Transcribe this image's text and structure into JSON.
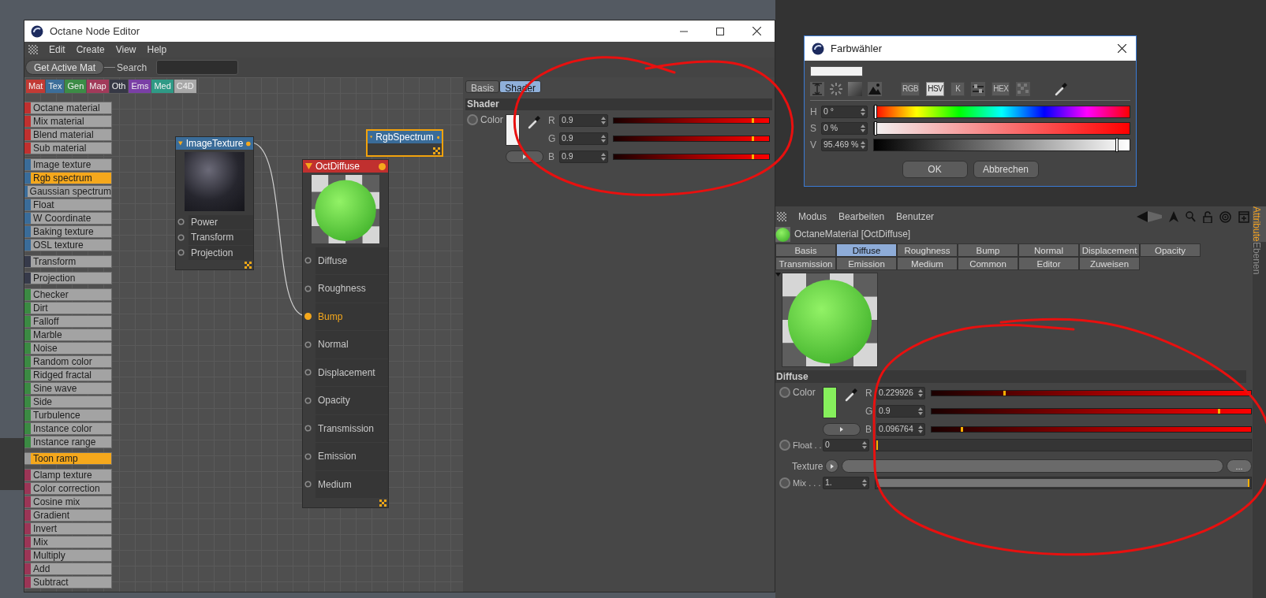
{
  "node_editor": {
    "title": "Octane Node Editor",
    "menu": [
      "Edit",
      "Create",
      "View",
      "Help"
    ],
    "toolbar": {
      "button": "Get Active Mat",
      "search_label": "Search"
    },
    "category_tabs": [
      {
        "label": "Mat",
        "color": "#c23a34"
      },
      {
        "label": "Tex",
        "color": "#3c6e9a"
      },
      {
        "label": "Gen",
        "color": "#3c8c46"
      },
      {
        "label": "Map",
        "color": "#a23a5a"
      },
      {
        "label": "Oth",
        "color": "#363845"
      },
      {
        "label": "Ems",
        "color": "#7a3fa6"
      },
      {
        "label": "Med",
        "color": "#2f9a86"
      },
      {
        "label": "C4D",
        "color": "#a8a8a8"
      }
    ],
    "node_groups": [
      {
        "color": "#c0302f",
        "items": [
          {
            "label": "Octane material",
            "selected": false
          },
          {
            "label": "Mix material",
            "selected": false
          },
          {
            "label": "Blend material",
            "selected": false
          },
          {
            "label": "Sub material",
            "selected": false
          }
        ]
      },
      {
        "color": "#3a6c99",
        "items": [
          {
            "label": "Image texture",
            "selected": false
          },
          {
            "label": "Rgb spectrum",
            "selected": true
          },
          {
            "label": "Gaussian spectrum",
            "selected": false
          },
          {
            "label": "Float",
            "selected": false
          },
          {
            "label": "W Coordinate",
            "selected": false
          },
          {
            "label": "Baking texture",
            "selected": false
          },
          {
            "label": "OSL texture",
            "selected": false
          }
        ]
      },
      {
        "color": "#363a4a",
        "items": [
          {
            "label": "Transform",
            "selected": false
          }
        ]
      },
      {
        "color": "#363a4a",
        "items": [
          {
            "label": "Projection",
            "selected": false
          }
        ]
      },
      {
        "color": "#3b8a43",
        "items": [
          {
            "label": "Checker",
            "selected": false
          },
          {
            "label": "Dirt",
            "selected": false
          },
          {
            "label": "Falloff",
            "selected": false
          },
          {
            "label": "Marble",
            "selected": false
          },
          {
            "label": "Noise",
            "selected": false
          },
          {
            "label": "Random color",
            "selected": false
          },
          {
            "label": "Ridged fractal",
            "selected": false
          },
          {
            "label": "Sine wave",
            "selected": false
          },
          {
            "label": "Side",
            "selected": false
          },
          {
            "label": "Turbulence",
            "selected": false
          },
          {
            "label": "Instance color",
            "selected": false
          },
          {
            "label": "Instance range",
            "selected": false
          }
        ]
      },
      {
        "color": "#9a9a9a",
        "items": [
          {
            "label": "Toon ramp",
            "selected": true
          }
        ]
      },
      {
        "color": "#9b3556",
        "items": [
          {
            "label": "Clamp texture",
            "selected": false
          },
          {
            "label": "Color correction",
            "selected": false
          },
          {
            "label": "Cosine mix",
            "selected": false
          },
          {
            "label": "Gradient",
            "selected": false
          },
          {
            "label": "Invert",
            "selected": false
          },
          {
            "label": "Mix",
            "selected": false
          },
          {
            "label": "Multiply",
            "selected": false
          },
          {
            "label": "Add",
            "selected": false
          },
          {
            "label": "Subtract",
            "selected": false
          }
        ]
      }
    ],
    "nodes": [
      {
        "kind": "texture",
        "title": "ImageTexture",
        "color": "#3a6c99",
        "selected": false,
        "ports": [
          {
            "label": "Power",
            "connected": false
          },
          {
            "label": "Transform",
            "connected": false
          },
          {
            "label": "Projection",
            "connected": false
          }
        ]
      },
      {
        "kind": "shader",
        "title": "OctDiffuse",
        "color": "#c0302f",
        "selected": false,
        "ports": [
          {
            "label": "Diffuse",
            "connected": false
          },
          {
            "label": "Roughness",
            "connected": false
          },
          {
            "label": "Bump",
            "connected": true
          },
          {
            "label": "Normal",
            "connected": false
          },
          {
            "label": "Displacement",
            "connected": false
          },
          {
            "label": "Opacity",
            "connected": false
          },
          {
            "label": "Transmission",
            "connected": false
          },
          {
            "label": "Emission",
            "connected": false
          },
          {
            "label": "Medium",
            "connected": false
          }
        ]
      },
      {
        "kind": "spectrum",
        "title": "RgbSpectrum",
        "color": "#3a6c99",
        "selected": true
      }
    ],
    "panel": {
      "tabs": [
        {
          "label": "Basis",
          "selected": false
        },
        {
          "label": "Shader",
          "selected": true
        }
      ],
      "section": "Shader",
      "color_label": "Color",
      "channels": [
        {
          "label": "R",
          "value": "0.9",
          "level": 0.9
        },
        {
          "label": "G",
          "value": "0.9",
          "level": 0.9
        },
        {
          "label": "B",
          "value": "0.9",
          "level": 0.9
        }
      ]
    }
  },
  "color_picker": {
    "title": "Farbwähler",
    "modes": [
      {
        "label": "RGB",
        "selected": false
      },
      {
        "label": "HSV",
        "selected": true
      },
      {
        "label": "K",
        "selected": false
      },
      {
        "label": "HEX",
        "selected": false
      }
    ],
    "rows": [
      {
        "kind": "hue",
        "label": "H",
        "value": "0 °",
        "level": 0
      },
      {
        "kind": "saturation",
        "label": "S",
        "value": "0 %",
        "level": 0
      },
      {
        "kind": "value",
        "label": "V",
        "value": "95.469 %",
        "level": 0.955
      }
    ],
    "buttons": [
      "OK",
      "Abbrechen"
    ]
  },
  "attribute_manager": {
    "menu": [
      "Modus",
      "Bearbeiten",
      "Benutzer"
    ],
    "object": "OctaneMaterial [OctDiffuse]",
    "tab_rows": [
      [
        {
          "label": "Basis",
          "selected": false
        },
        {
          "label": "Diffuse",
          "selected": true
        },
        {
          "label": "Roughness",
          "selected": false
        },
        {
          "label": "Bump",
          "selected": false
        },
        {
          "label": "Normal",
          "selected": false
        },
        {
          "label": "Displacement",
          "selected": false
        },
        {
          "label": "Opacity",
          "selected": false
        }
      ],
      [
        {
          "label": "Transmission",
          "selected": false
        },
        {
          "label": "Emission",
          "selected": false
        },
        {
          "label": "Medium",
          "selected": false
        },
        {
          "label": "Common",
          "selected": false
        },
        {
          "label": "Editor",
          "selected": false
        },
        {
          "label": "Zuweisen",
          "selected": false
        }
      ]
    ],
    "section": "Diffuse",
    "color": {
      "label": "Color",
      "channels": [
        {
          "label": "R",
          "value": "0.229926",
          "level": 0.23
        },
        {
          "label": "G",
          "value": "0.9",
          "level": 0.9
        },
        {
          "label": "B",
          "value": "0.096764",
          "level": 0.097
        }
      ]
    },
    "float": {
      "label": "Float . .",
      "value": "0",
      "level": 0
    },
    "texture": {
      "label": "Texture",
      "browse": "..."
    },
    "mix": {
      "label": "Mix . . .",
      "value": "1.",
      "level": 1
    },
    "side_tabs": [
      {
        "label": "Attribute",
        "selected": true
      },
      {
        "label": "Ebenen",
        "selected": false
      }
    ]
  }
}
